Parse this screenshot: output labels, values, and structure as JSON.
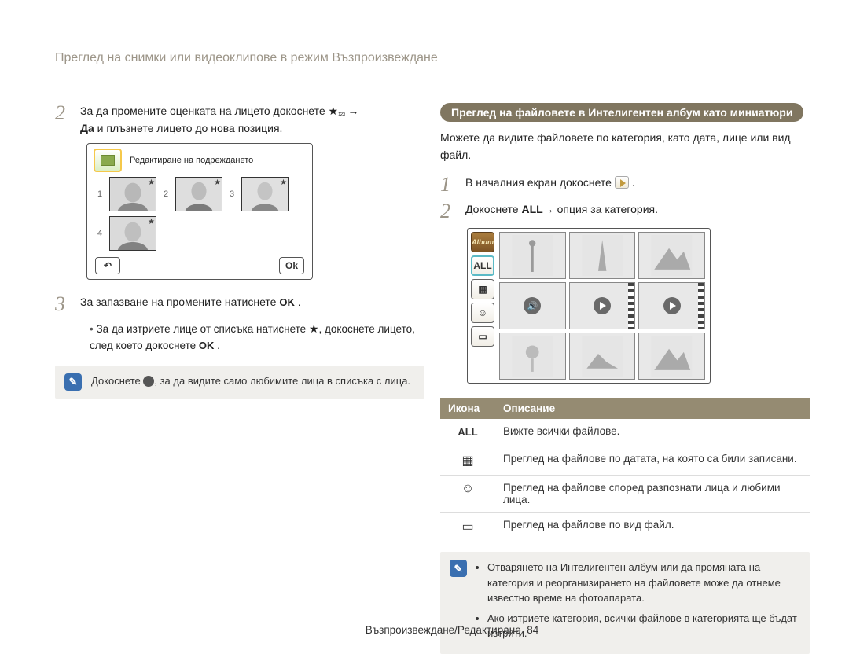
{
  "header": "Преглед на снимки или видеоклипове в режим Възпроизвеждане",
  "left": {
    "step2_a": "За да промените оценката на лицето докоснете ",
    "step2_b": "Да",
    "step2_c": " и плъзнете лицето до нова позиция.",
    "camera_title": "Редактиране на подреждането",
    "idx": {
      "i1": "1",
      "i2": "2",
      "i3": "3",
      "i4": "4"
    },
    "ok_label": "Ok",
    "step3": "За запазване на промените натиснете ",
    "bullet1a": "За да изтриете лице от списъка натиснете ",
    "bullet1b": ", докоснете лицето, след което докоснете ",
    "note": "Докоснете ",
    "note_b": ", за да видите само любимите лица в списъка с лица."
  },
  "right": {
    "pill": "Преглед на файловете в Интелигентен албум като миниатюри",
    "intro": "Можете да видите файловете по категория, като дата, лице или вид файл.",
    "step1": "В началния екран докоснете ",
    "step2_a": "Докоснете ",
    "step2_all": "ALL",
    "step2_b": "→ опция за категория.",
    "sidebar": {
      "album": "Album",
      "all": "ALL"
    },
    "table": {
      "h1": "Икона",
      "h2": "Описание",
      "rows": [
        {
          "icon": "ALL",
          "desc": "Вижте всички файлове."
        },
        {
          "icon": "calendar",
          "desc": "Преглед на файлове по датата, на която са били записани."
        },
        {
          "icon": "person",
          "desc": "Преглед на файлове според разпознати лица и любими лица."
        },
        {
          "icon": "folder",
          "desc": "Преглед на файлове по вид файл."
        }
      ]
    },
    "note_items": [
      "Отварянето на Интелигентен албум или да промяната на категория и реорганизирането на файловете може да отнеме известно време на фотоапарата.",
      "Ако изтриете категория, всички файлове в категорията ще бъдат изтрити."
    ]
  },
  "footer": {
    "section": "Възпроизвеждане/Редактиране",
    "page": "84"
  }
}
